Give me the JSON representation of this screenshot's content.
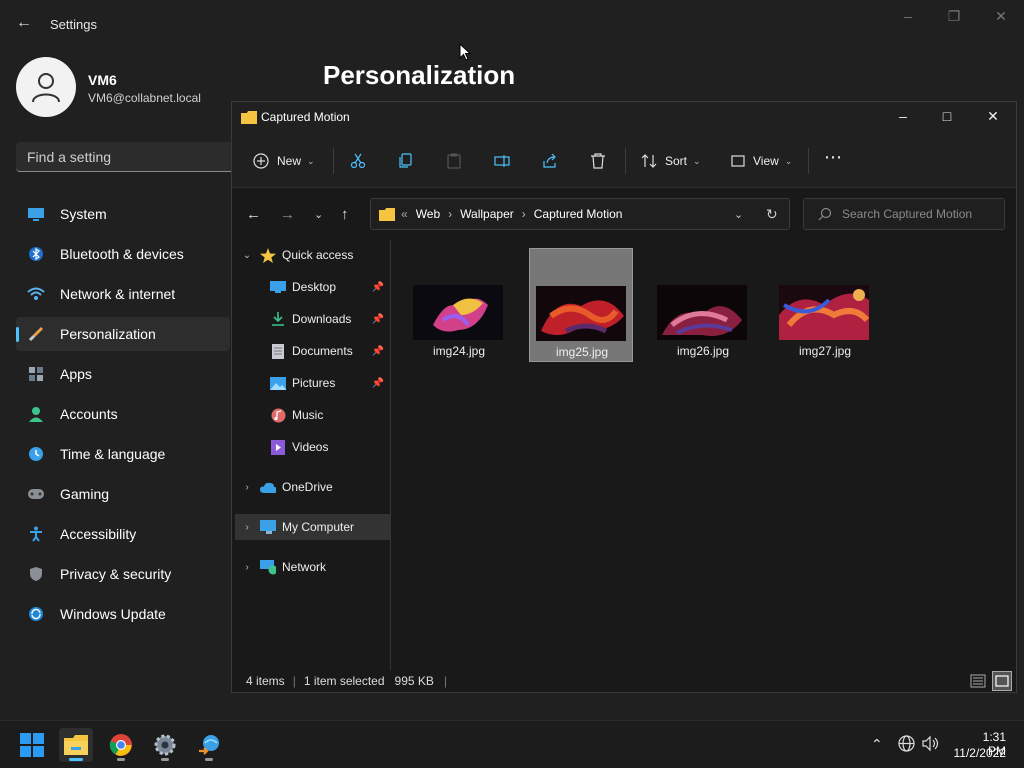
{
  "settings": {
    "title": "Settings",
    "user": {
      "name": "VM6",
      "email": "VM6@collabnet.local"
    },
    "page_heading": "Personalization",
    "search_placeholder": "Find a setting",
    "nav": [
      {
        "label": "System",
        "icon": "system-icon"
      },
      {
        "label": "Bluetooth & devices",
        "icon": "bluetooth-icon"
      },
      {
        "label": "Network & internet",
        "icon": "wifi-icon"
      },
      {
        "label": "Personalization",
        "icon": "brush-icon",
        "active": true
      },
      {
        "label": "Apps",
        "icon": "apps-icon"
      },
      {
        "label": "Accounts",
        "icon": "accounts-icon"
      },
      {
        "label": "Time & language",
        "icon": "clock-globe-icon"
      },
      {
        "label": "Gaming",
        "icon": "gamepad-icon"
      },
      {
        "label": "Accessibility",
        "icon": "accessibility-icon"
      },
      {
        "label": "Privacy & security",
        "icon": "shield-icon"
      },
      {
        "label": "Windows Update",
        "icon": "update-icon"
      }
    ]
  },
  "explorer": {
    "title": "Captured Motion",
    "toolbar": {
      "new_label": "New",
      "sort_label": "Sort",
      "view_label": "View"
    },
    "breadcrumb": {
      "overflow": "«",
      "parts": [
        "Web",
        "Wallpaper",
        "Captured Motion"
      ]
    },
    "search_placeholder": "Search Captured Motion",
    "tree": [
      {
        "label": "Quick access",
        "expanded": true
      },
      {
        "label": "Desktop",
        "pinned": true
      },
      {
        "label": "Downloads",
        "pinned": true
      },
      {
        "label": "Documents",
        "pinned": true
      },
      {
        "label": "Pictures",
        "pinned": true
      },
      {
        "label": "Music"
      },
      {
        "label": "Videos"
      },
      {
        "label": "OneDrive"
      },
      {
        "label": "My Computer",
        "selected": true
      },
      {
        "label": "Network"
      }
    ],
    "files": [
      {
        "name": "img24.jpg"
      },
      {
        "name": "img25.jpg",
        "selected": true
      },
      {
        "name": "img26.jpg"
      },
      {
        "name": "img27.jpg"
      }
    ],
    "status": {
      "count": "4 items",
      "selection": "1 item selected",
      "size": "995 KB"
    }
  },
  "taskbar": {
    "time": "1:31 PM",
    "date": "11/2/2022"
  },
  "colors": {
    "accent": "#4cc2ff",
    "folder": "#f5c542"
  }
}
